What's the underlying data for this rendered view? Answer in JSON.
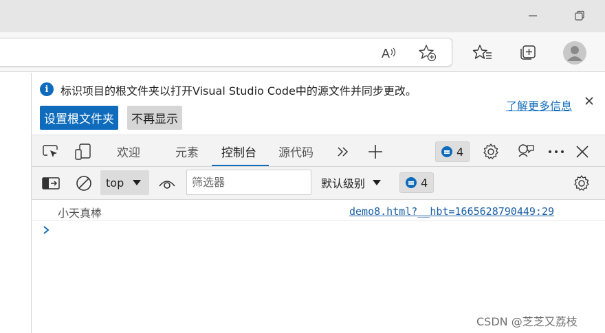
{
  "browser": {
    "toolbar_icons": [
      "read-aloud-icon",
      "add-favorite-icon",
      "favorites-icon",
      "collections-icon",
      "profile-icon"
    ]
  },
  "infobar": {
    "message": "标识项目的根文件夹以打开Visual Studio Code中的源文件并同步更改。",
    "set_root_button": "设置根文件夹",
    "dont_show_button": "不再显示",
    "learn_more_link": "了解更多信息"
  },
  "tabs": [
    {
      "label": "欢迎"
    },
    {
      "label": "元素"
    },
    {
      "label": "控制台",
      "active": true
    },
    {
      "label": "源代码"
    }
  ],
  "issues_count": "4",
  "console_toolbar": {
    "context": "top",
    "filter_placeholder": "筛选器",
    "level": "默认级别",
    "issues_count": "4"
  },
  "console": {
    "log_message": "小天真棒",
    "log_source": "demo8.html?__hbt=1665628790449:29"
  },
  "watermark": "CSDN @芝芝又荔枝",
  "colors": {
    "accent": "#0f6cbd",
    "titlebar": "#e6e6e6",
    "toolbar": "#f3f3f3"
  }
}
